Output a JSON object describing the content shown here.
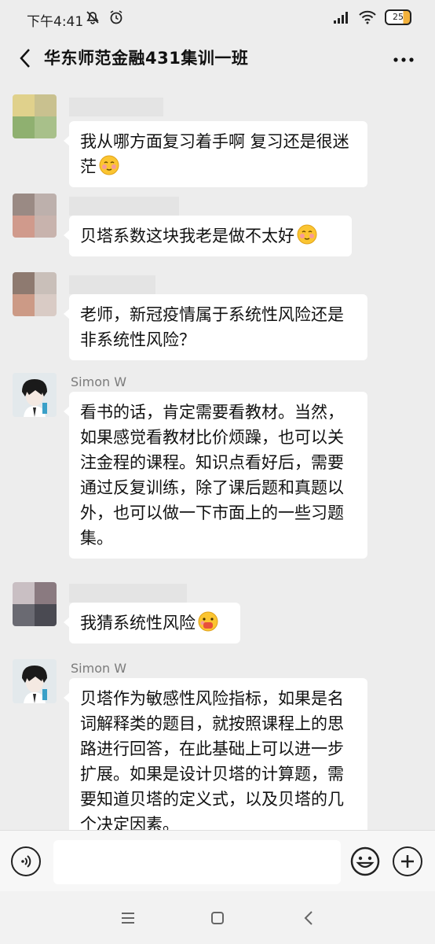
{
  "status": {
    "time": "下午4:41",
    "battery": "25"
  },
  "header": {
    "title": "华东师范金融431集训一班"
  },
  "messages": [
    {
      "sender": "",
      "text": "我从哪方面复习着手啊 复习还是很迷茫",
      "emoji": "flushed-smile-emoji"
    },
    {
      "sender": "",
      "text": "贝塔系数这块我老是做不太好",
      "emoji": "flushed-smile-emoji"
    },
    {
      "sender": "",
      "text": "老师，新冠疫情属于系统性风险还是非系统性风险？"
    },
    {
      "sender": "Simon W",
      "text": "看书的话，肯定需要看教材。当然，如果感觉看教材比价烦躁，也可以关注金程的课程。知识点看好后，需要通过反复训练，除了课后题和真题以外，也可以做一下市面上的一些习题集。"
    },
    {
      "sender": "",
      "text": "我猜系统性风险",
      "emoji": "mask-face-emoji"
    },
    {
      "sender": "Simon W",
      "text": "贝塔作为敏感性风险指标，如果是名词解释类的题目，就按照课程上的思路进行回答，在此基础上可以进一步扩展。如果是设计贝塔的计算题，需要知道贝塔的定义式，以及贝塔的几个决定因素。"
    }
  ],
  "input": {
    "placeholder": ""
  },
  "colors": {
    "background": "#ededed",
    "bubble": "#ffffff",
    "name": "#7b7b7b"
  }
}
